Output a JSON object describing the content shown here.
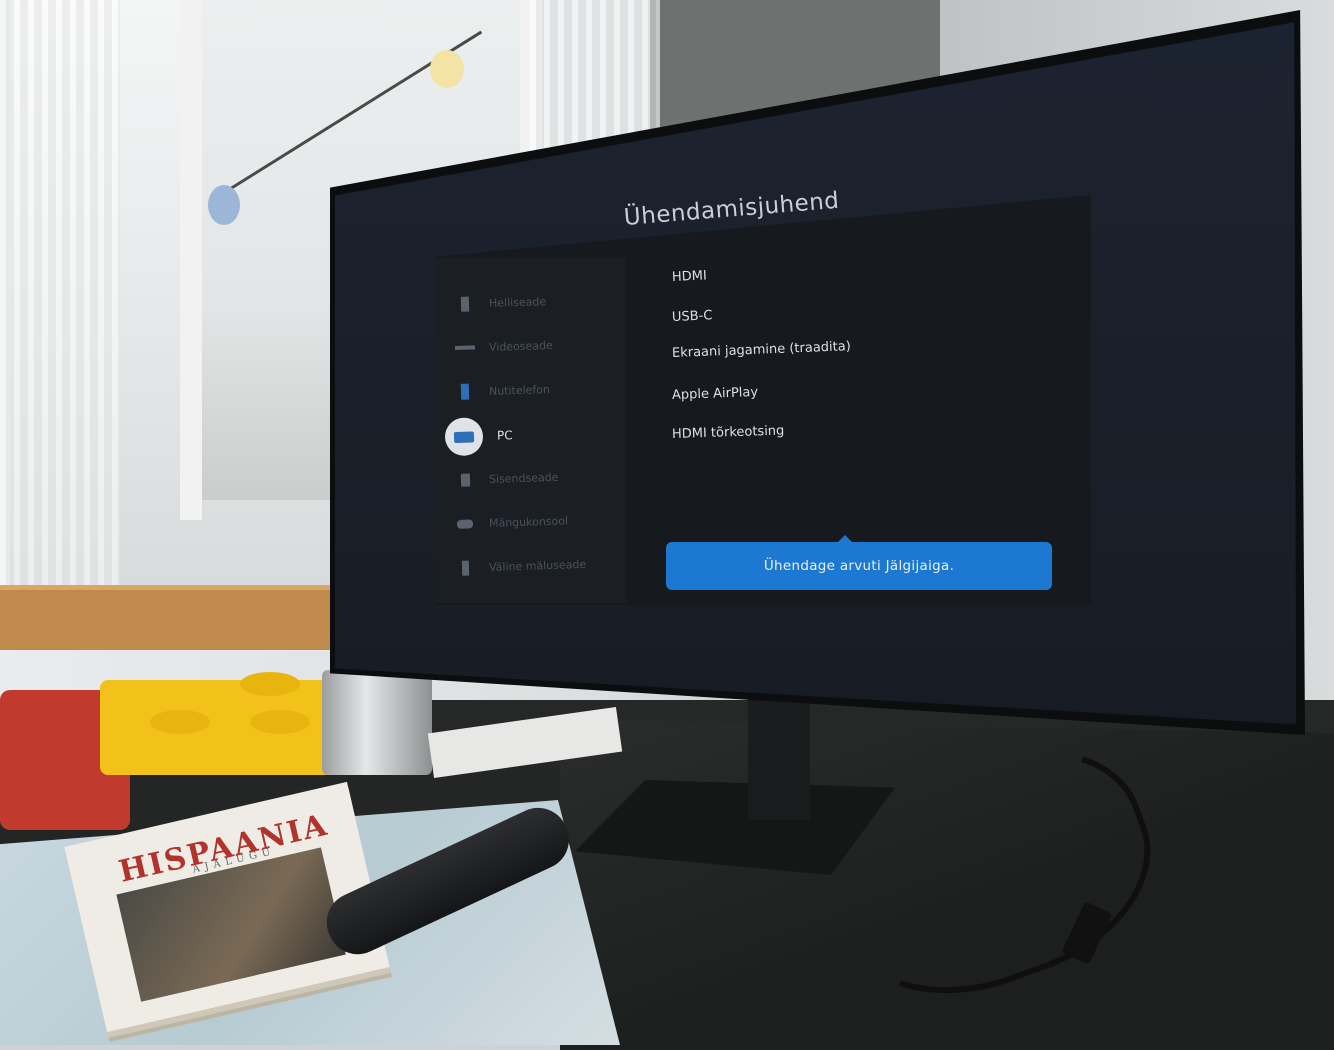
{
  "screen": {
    "title": "Ühendamisjuhend",
    "categories": [
      {
        "label": "Helliseade",
        "icon": "speaker-icon"
      },
      {
        "label": "Videoseade",
        "icon": "video-device-icon"
      },
      {
        "label": "Nutitelefon",
        "icon": "smartphone-icon"
      },
      {
        "label": "PC",
        "icon": "pc-monitor-icon",
        "selected": true
      },
      {
        "label": "Sisendseade",
        "icon": "input-device-icon"
      },
      {
        "label": "Mängukonsool",
        "icon": "gamepad-icon"
      },
      {
        "label": "Väline mäluseade",
        "icon": "usb-storage-icon"
      }
    ],
    "options": [
      "HDMI",
      "USB-C",
      "Ekraani jagamine (traadita)",
      "Apple AirPlay",
      "HDMI tõrkeotsing"
    ],
    "tooltip": "Ühendage arvuti Jälgijaiga.",
    "accent_color": "#1d78d2"
  },
  "book": {
    "title": "HISPAANIA",
    "subtitle": "AJALUGU"
  }
}
